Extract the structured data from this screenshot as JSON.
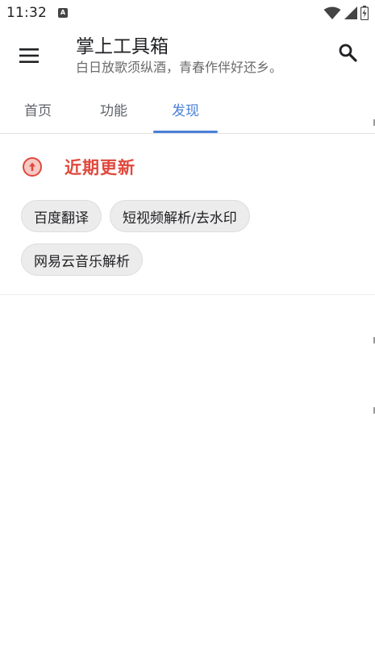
{
  "status": {
    "time": "11:32",
    "notif_glyph": "A"
  },
  "app_bar": {
    "title": "掌上工具箱",
    "subtitle": "白日放歌须纵酒，青春作伴好还乡。"
  },
  "tabs": [
    {
      "label": "首页",
      "active": false
    },
    {
      "label": "功能",
      "active": false
    },
    {
      "label": "发现",
      "active": true
    }
  ],
  "section": {
    "title": "近期更新",
    "icon": "arrow-up-circle-icon",
    "accent": "#e0483c",
    "chips": [
      "百度翻译",
      "短视频解析/去水印",
      "网易云音乐解析"
    ]
  },
  "colors": {
    "tab_active": "#4a7fd8",
    "chip_bg": "#ececec"
  }
}
